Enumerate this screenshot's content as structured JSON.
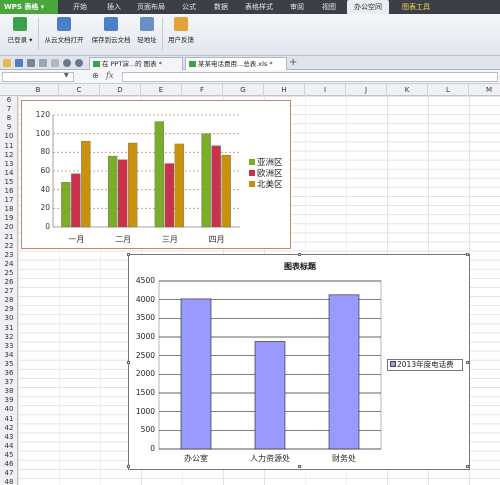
{
  "app": {
    "name": "WPS 表格"
  },
  "ribbon_tabs": [
    {
      "label": "开始"
    },
    {
      "label": "插入"
    },
    {
      "label": "页面布局"
    },
    {
      "label": "公式"
    },
    {
      "label": "数据"
    },
    {
      "label": "表格样式"
    },
    {
      "label": "审阅"
    },
    {
      "label": "视图"
    },
    {
      "label": "办公空间"
    },
    {
      "label": "图表工具"
    }
  ],
  "ribbon_buttons": [
    {
      "label": "已登录"
    },
    {
      "label": "从云文档打开"
    },
    {
      "label": "保存到云文档"
    },
    {
      "label": "轻地址"
    },
    {
      "label": "用户反馈"
    }
  ],
  "doc_tabs": [
    {
      "label": "在 PPT演...的 图表 *"
    },
    {
      "label": "某某电话费用...总表.xls *"
    }
  ],
  "formula_bar": {
    "fx": "fx",
    "value": ""
  },
  "columns": [
    "B",
    "C",
    "D",
    "E",
    "F",
    "G",
    "H",
    "I",
    "J",
    "K",
    "L",
    "M"
  ],
  "rows": [
    "6",
    "7",
    "8",
    "9",
    "10",
    "11",
    "12",
    "13",
    "14",
    "15",
    "16",
    "17",
    "18",
    "19",
    "20",
    "21",
    "22",
    "23",
    "24",
    "25",
    "26",
    "27",
    "28",
    "29",
    "30",
    "31",
    "32",
    "33",
    "34",
    "35",
    "36",
    "37",
    "38",
    "39",
    "40",
    "41",
    "42",
    "43",
    "44",
    "45",
    "46",
    "47",
    "48"
  ],
  "colors": {
    "asia": "#7aae2a",
    "europe": "#c8324a",
    "namerica": "#c8920e",
    "phone": "#9999ff"
  },
  "chart_data": [
    {
      "type": "bar",
      "categories": [
        "一月",
        "二月",
        "三月",
        "四月"
      ],
      "series": [
        {
          "name": "亚洲区",
          "values": [
            48,
            76,
            113,
            100
          ]
        },
        {
          "name": "欧洲区",
          "values": [
            57,
            72,
            68,
            87
          ]
        },
        {
          "name": "北美区",
          "values": [
            92,
            90,
            89,
            77
          ]
        }
      ],
      "ylim": [
        0,
        120
      ],
      "yticks": [
        "0",
        "20",
        "40",
        "60",
        "80",
        "100",
        "120"
      ],
      "grid": true,
      "legend_position": "right"
    },
    {
      "type": "bar",
      "title": "图表标题",
      "categories": [
        "办公室",
        "人力资源处",
        "财务处"
      ],
      "series": [
        {
          "name": "2013年度电话费",
          "values": [
            4020,
            2880,
            4130
          ]
        }
      ],
      "ylim": [
        0,
        4500
      ],
      "yticks": [
        "0",
        "500",
        "1000",
        "1500",
        "2000",
        "2500",
        "3000",
        "3500",
        "4000",
        "4500"
      ],
      "grid": true,
      "legend_position": "right"
    }
  ]
}
